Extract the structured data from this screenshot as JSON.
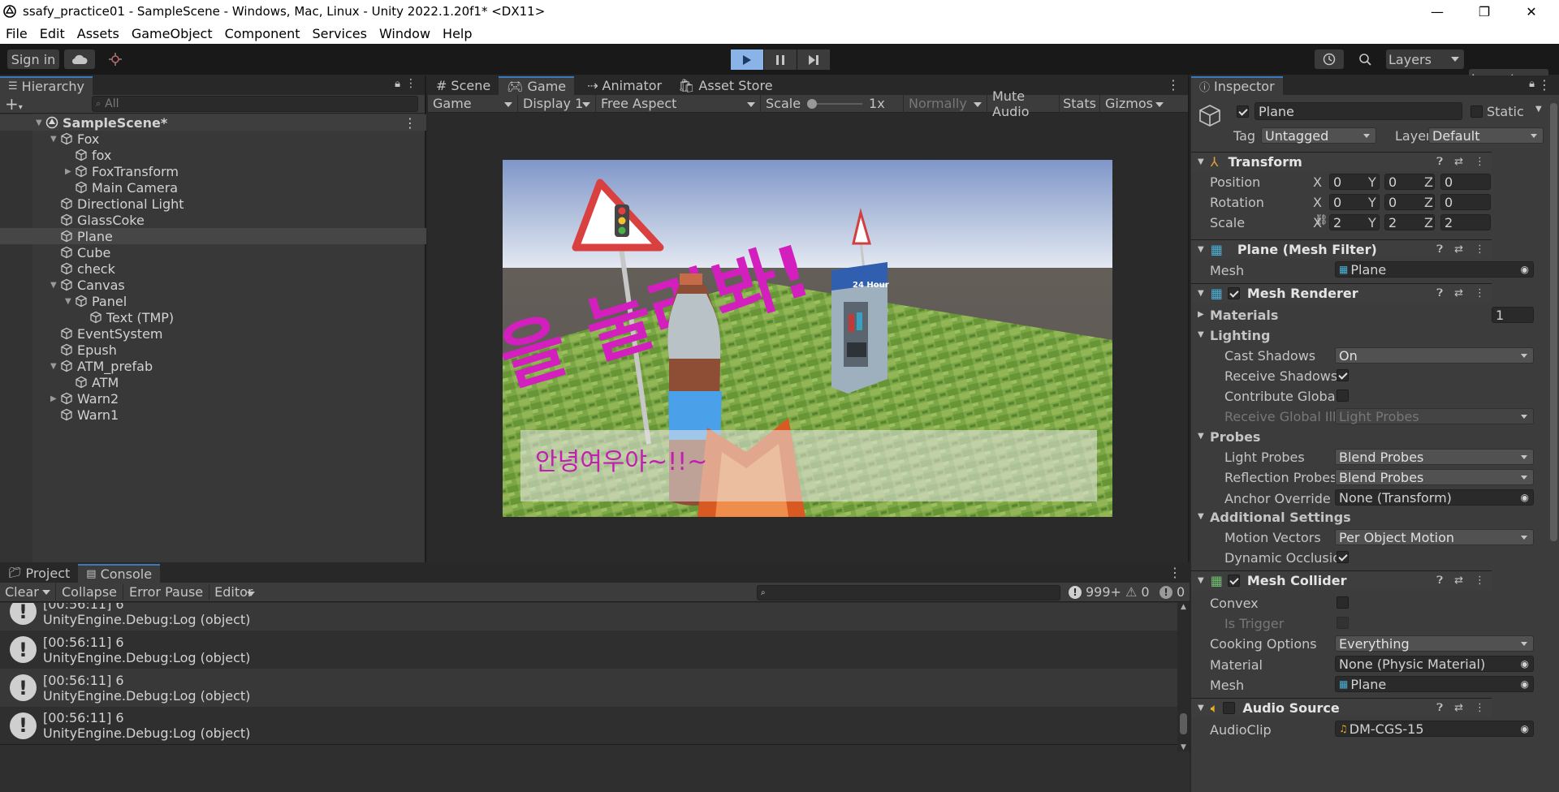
{
  "titlebar": {
    "title": "ssafy_practice01 - SampleScene - Windows, Mac, Linux - Unity 2022.1.20f1* <DX11>",
    "minimize": "—",
    "restore": "❐",
    "close": "✕"
  },
  "menu": [
    "File",
    "Edit",
    "Assets",
    "GameObject",
    "Component",
    "Services",
    "Window",
    "Help"
  ],
  "toolbar": {
    "sign_in": "Sign in",
    "layers": "Layers",
    "layout": "Layout"
  },
  "hierarchy": {
    "tab": "Hierarchy",
    "search_placeholder": "All",
    "scene": "SampleScene*",
    "items": [
      {
        "label": "Fox"
      },
      {
        "label": "fox"
      },
      {
        "label": "FoxTransform"
      },
      {
        "label": "Main Camera"
      },
      {
        "label": "Directional Light"
      },
      {
        "label": "GlassCoke"
      },
      {
        "label": "Plane"
      },
      {
        "label": "Cube"
      },
      {
        "label": "check"
      },
      {
        "label": "Canvas"
      },
      {
        "label": "Panel"
      },
      {
        "label": "Text (TMP)"
      },
      {
        "label": "EventSystem"
      },
      {
        "label": "Epush"
      },
      {
        "label": "ATM_prefab"
      },
      {
        "label": "ATM"
      },
      {
        "label": "Warn2"
      },
      {
        "label": "Warn1"
      }
    ]
  },
  "gameview": {
    "tabs": [
      "Scene",
      "Game",
      "Animator",
      "Asset Store"
    ],
    "display_mode": "Game",
    "display": "Display 1",
    "aspect": "Free Aspect",
    "scale_label": "Scale",
    "scale_value": "1x",
    "normally": "Normally",
    "mute_audio": "Mute Audio",
    "stats": "Stats",
    "gizmos": "Gizmos",
    "scene_text_big": "을 눌러봐!",
    "atm_sign": "24 Hour",
    "dialog_text": "안녕여우야~!!~"
  },
  "console": {
    "tabs": [
      "Project",
      "Console"
    ],
    "clear": "Clear",
    "collapse": "Collapse",
    "error_pause": "Error Pause",
    "editor": "Editor",
    "count_log": "999+",
    "count_warn": "0",
    "count_error": "0",
    "partial_time": "[00:56:11] 6",
    "partial_msg": "UnityEngine.Debug:Log (object)",
    "logs": [
      {
        "time": "[00:56:11] 6",
        "msg": "UnityEngine.Debug:Log (object)"
      },
      {
        "time": "[00:56:11] 6",
        "msg": "UnityEngine.Debug:Log (object)"
      },
      {
        "time": "[00:56:11] 6",
        "msg": "UnityEngine.Debug:Log (object)"
      }
    ]
  },
  "inspector": {
    "tab": "Inspector",
    "object_name": "Plane",
    "static": "Static",
    "tag_label": "Tag",
    "tag": "Untagged",
    "layer_label": "Layer",
    "layer": "Default",
    "transform": {
      "title": "Transform",
      "position": "Position",
      "rotation": "Rotation",
      "scale": "Scale",
      "pos": [
        "0",
        "0",
        "0"
      ],
      "rot": [
        "0",
        "0",
        "0"
      ],
      "scl": [
        "2",
        "2",
        "2"
      ],
      "axes": [
        "X",
        "Y",
        "Z"
      ]
    },
    "mesh_filter": {
      "title": "Plane (Mesh Filter)",
      "mesh_label": "Mesh",
      "mesh": "Plane"
    },
    "mesh_renderer": {
      "title": "Mesh Renderer",
      "materials": "Materials",
      "materials_count": "1",
      "lighting": "Lighting",
      "cast_shadows": "Cast Shadows",
      "cast_shadows_val": "On",
      "receive_shadows": "Receive Shadows",
      "contribute_gi": "Contribute Global I",
      "receive_gi": "Receive Global Illu",
      "receive_gi_val": "Light Probes",
      "probes": "Probes",
      "light_probes": "Light Probes",
      "light_probes_val": "Blend Probes",
      "reflection_probes": "Reflection Probes",
      "reflection_probes_val": "Blend Probes",
      "anchor_override": "Anchor Override",
      "anchor_override_val": "None (Transform)",
      "additional": "Additional Settings",
      "motion_vectors": "Motion Vectors",
      "motion_vectors_val": "Per Object Motion",
      "dynamic_occlusion": "Dynamic Occlusio"
    },
    "mesh_collider": {
      "title": "Mesh Collider",
      "convex": "Convex",
      "is_trigger": "Is Trigger",
      "cooking": "Cooking Options",
      "cooking_val": "Everything",
      "material": "Material",
      "material_val": "None (Physic Material)",
      "mesh": "Mesh",
      "mesh_val": "Plane"
    },
    "audio_source": {
      "title": "Audio Source",
      "clip_label": "AudioClip",
      "clip": "DM-CGS-15"
    }
  }
}
